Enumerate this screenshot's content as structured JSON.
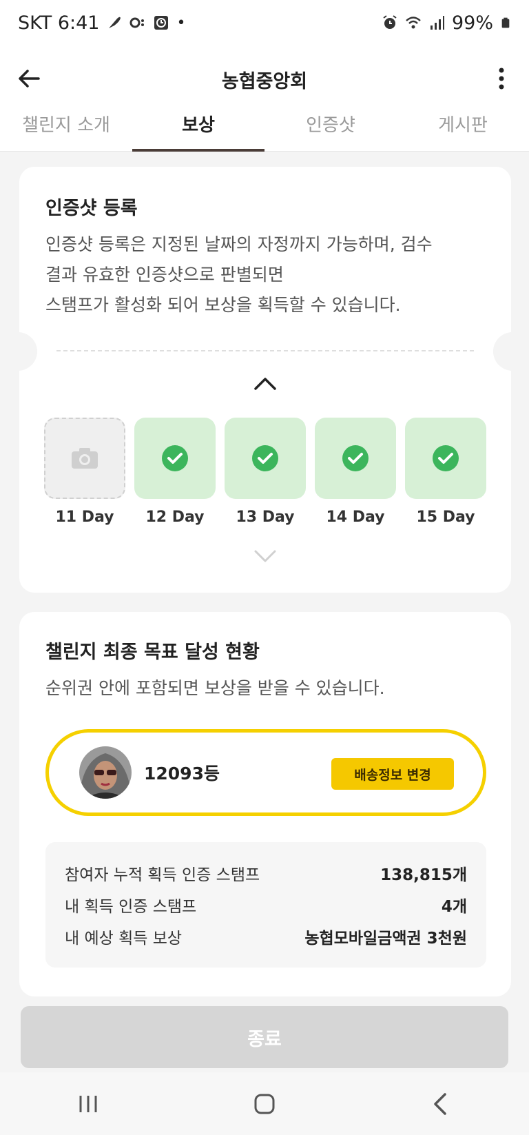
{
  "status_bar": {
    "carrier_time": "SKT 6:41",
    "battery": "99%"
  },
  "header": {
    "title": "농협중앙회"
  },
  "tabs": [
    {
      "label": "챌린지 소개"
    },
    {
      "label": "보상"
    },
    {
      "label": "인증샷"
    },
    {
      "label": "게시판"
    }
  ],
  "registration": {
    "title": "인증샷 등록",
    "desc_line1": "인증샷 등록은 지정된 날짜의 자정까지 가능하며, 검수",
    "desc_line2": "결과 유효한 인증샷으로 판별되면",
    "desc_line3": "스탬프가 활성화 되어 보상을 획득할 수 있습니다.",
    "days": [
      {
        "label": "11 Day",
        "status": "empty"
      },
      {
        "label": "12 Day",
        "status": "done"
      },
      {
        "label": "13 Day",
        "status": "done"
      },
      {
        "label": "14 Day",
        "status": "done"
      },
      {
        "label": "15 Day",
        "status": "done"
      }
    ]
  },
  "goal": {
    "title": "챌린지 최종 목표 달성 현황",
    "desc": "순위권 안에 포함되면 보상을 받을 수 있습니다.",
    "rank": "12093등",
    "ship_button": "배송정보 변경",
    "stats": [
      {
        "key": "참여자 누적 획득 인증 스탬프",
        "value": "138,815개"
      },
      {
        "key": "내 획득 인증 스탬프",
        "value": "4개"
      },
      {
        "key": "내 예상 획득 보상",
        "value": "농협모바일금액권 3천원"
      }
    ]
  },
  "footer": {
    "end_button": "종료"
  },
  "colors": {
    "accent_yellow": "#f5d000",
    "done_green": "#3cb55c",
    "done_bg": "#d7f0d6",
    "tab_indicator": "#4a3c37"
  }
}
